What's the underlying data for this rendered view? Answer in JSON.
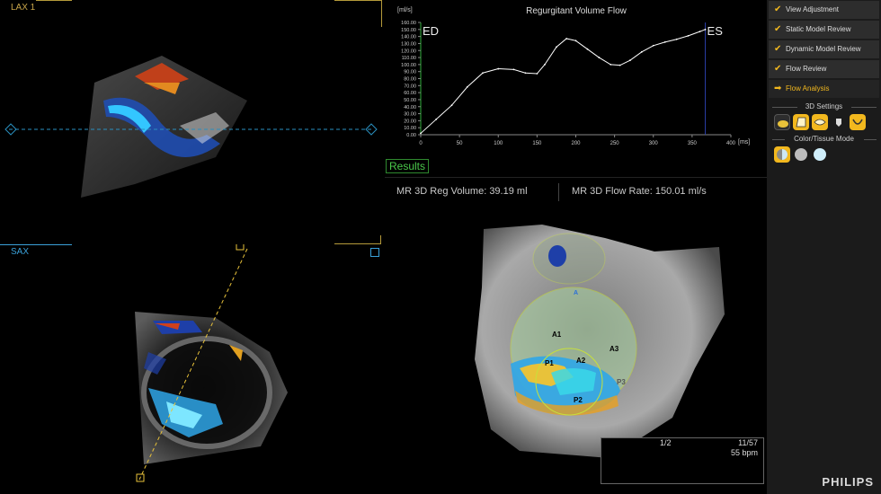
{
  "viewports": {
    "lax": {
      "label": "LAX 1"
    },
    "sax": {
      "label": "SAX"
    }
  },
  "chart": {
    "y_unit": "[ml/s]",
    "x_unit": "[ms]",
    "ed_label": "ED",
    "es_label": "ES"
  },
  "chart_data": {
    "type": "line",
    "title": "Regurgitant Volume Flow",
    "xlabel": "[ms]",
    "ylabel": "[ml/s]",
    "xlim": [
      0,
      400
    ],
    "ylim": [
      0,
      160
    ],
    "x_ticks": [
      0,
      50,
      100,
      150,
      200,
      250,
      300,
      350,
      400
    ],
    "y_ticks": [
      "0.00",
      "10.00",
      "20.00",
      "30.00",
      "40.00",
      "50.00",
      "60.00",
      "70.00",
      "80.00",
      "90.00",
      "100.00",
      "110.00",
      "120.00",
      "130.00",
      "140.00",
      "150.00",
      "160.00"
    ],
    "markers": [
      {
        "label": "ED",
        "x": 0
      },
      {
        "label": "ES",
        "x": 367
      }
    ],
    "series": [
      {
        "x": [
          0,
          20,
          40,
          60,
          80,
          100,
          120,
          135,
          150,
          160,
          175,
          188,
          200,
          215,
          230,
          245,
          257,
          270,
          285,
          300,
          315,
          330,
          345,
          360,
          367
        ],
        "y": [
          2,
          22,
          42,
          68,
          88,
          94,
          93,
          88,
          87,
          100,
          125,
          137,
          134,
          122,
          110,
          100,
          99,
          106,
          118,
          127,
          132,
          136,
          141,
          147,
          150
        ],
        "color": "#ffffff"
      }
    ],
    "grid": false
  },
  "results": {
    "tab_label": "Results",
    "reg_volume": "MR 3D Reg Volume: 39.19 ml",
    "flow_rate": "MR 3D Flow Rate: 150.01 ml/s"
  },
  "view3d": {
    "labels": [
      "A1",
      "A2",
      "A3",
      "P1",
      "P2",
      "P3",
      "A"
    ],
    "ecg": {
      "page": "1/2",
      "frame": "11/57",
      "bpm": "55 bpm"
    }
  },
  "sidebar": {
    "items": [
      {
        "label": "View Adjustment",
        "icon": "check-icon"
      },
      {
        "label": "Static Model Review",
        "icon": "check-icon"
      },
      {
        "label": "Dynamic Model Review",
        "icon": "check-icon"
      },
      {
        "label": "Flow Review",
        "icon": "check-icon"
      },
      {
        "label": "Flow Analysis",
        "icon": "arrow-right-icon",
        "active": true
      }
    ],
    "settings_title": "3D Settings",
    "color_mode_title": "Color/Tissue Mode"
  },
  "brand": "PHILIPS",
  "colors": {
    "accent": "#f2b81e",
    "results_green": "#4ac84a",
    "lax_label": "#c8a54a",
    "sax_label": "#3aa0d8"
  }
}
